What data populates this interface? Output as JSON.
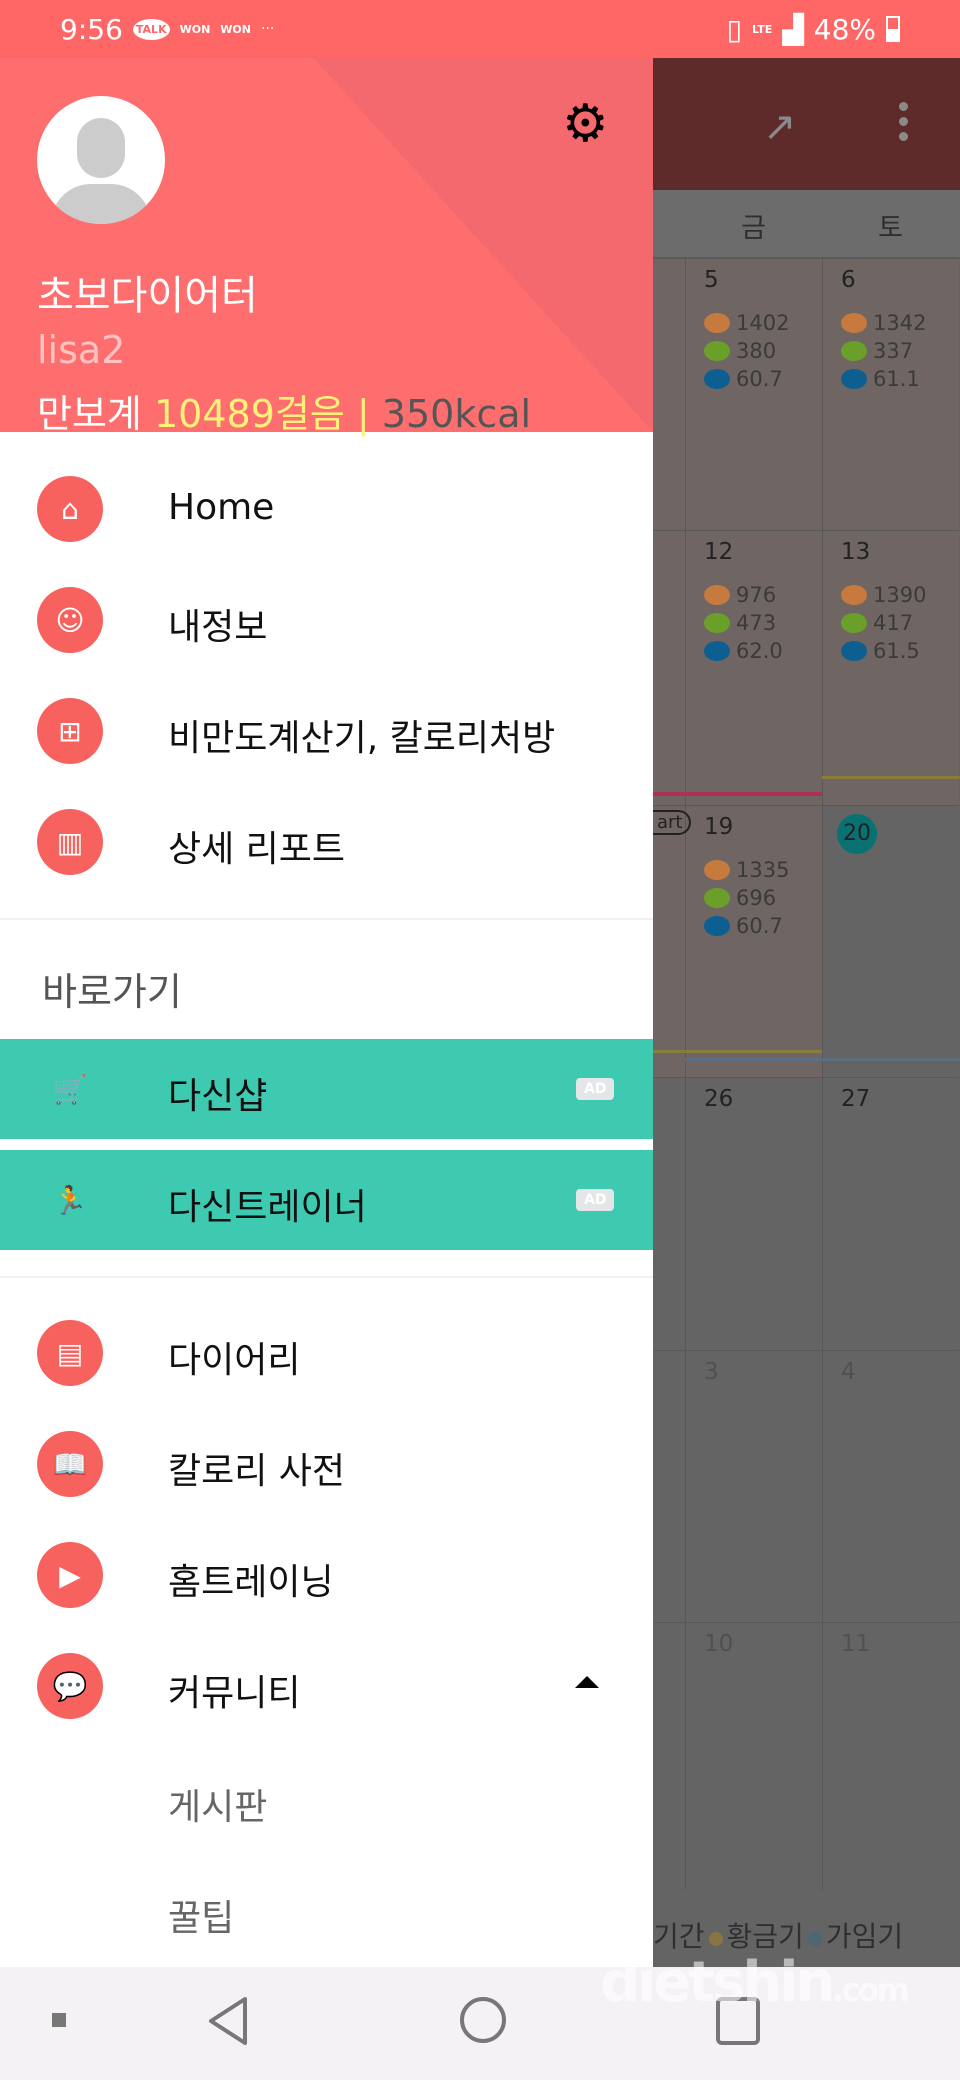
{
  "status_bar": {
    "time": "9:56",
    "notif_talk": "TALK",
    "notif_won1": "WON",
    "notif_won2": "WON",
    "more": "···",
    "network": "LTE",
    "battery": "48%",
    "battery_level": 48
  },
  "toolbar": {
    "trend_icon": "trending-up-icon",
    "menu_icon": "more-vert-icon"
  },
  "calendar": {
    "weekdays": [
      "금",
      "토"
    ],
    "rows": [
      [
        {
          "day": "5",
          "food": "1402",
          "exercise": "380",
          "weight": "60.7"
        },
        {
          "day": "6",
          "food": "1342",
          "exercise": "337",
          "weight": "61.1"
        }
      ],
      [
        {
          "day": "12",
          "food": "976",
          "exercise": "473",
          "weight": "62.0"
        },
        {
          "day": "13",
          "food": "1390",
          "exercise": "417",
          "weight": "61.5"
        }
      ],
      [
        {
          "day": "19",
          "food": "1335",
          "exercise": "696",
          "weight": "60.7"
        },
        {
          "day": "20"
        }
      ],
      [
        {
          "day": "26"
        },
        {
          "day": "27"
        }
      ],
      [
        {
          "day": "3"
        },
        {
          "day": "4"
        }
      ],
      [
        {
          "day": "10"
        },
        {
          "day": "11"
        }
      ]
    ],
    "start_tag": "art",
    "legend": {
      "period": "기간",
      "golden": "황금기",
      "fertile": "가임기"
    },
    "colors": {
      "food": "#c77a3e",
      "exercise": "#6aa02a",
      "weight": "#0d5f91",
      "today": "#087272"
    }
  },
  "drawer": {
    "nickname": "초보다이어터",
    "user_id": "lisa2",
    "pedometer_label": "만보계",
    "steps": "10489걸음",
    "separator": "|",
    "kcal": "350kcal",
    "menu": [
      {
        "label": "Home",
        "icon": "home-icon"
      },
      {
        "label": "내정보",
        "icon": "user-icon"
      },
      {
        "label": "비만도계산기, 칼로리처방",
        "icon": "calculator-icon"
      },
      {
        "label": "상세 리포트",
        "icon": "bar-chart-icon"
      }
    ],
    "shortcut_title": "바로가기",
    "shortcuts": [
      {
        "label": "다신샵",
        "icon": "cart-icon",
        "badge": "AD"
      },
      {
        "label": "다신트레이너",
        "icon": "runner-icon",
        "badge": "AD"
      }
    ],
    "menu2": [
      {
        "label": "다이어리",
        "icon": "diary-icon"
      },
      {
        "label": "칼로리 사전",
        "icon": "book-icon"
      },
      {
        "label": "홈트레이닝",
        "icon": "video-icon"
      },
      {
        "label": "커뮤니티",
        "icon": "chat-icon"
      }
    ],
    "community_sub": [
      "게시판",
      "꿀팁"
    ],
    "accent": "#f7625f"
  },
  "watermark": "dietshin.com"
}
